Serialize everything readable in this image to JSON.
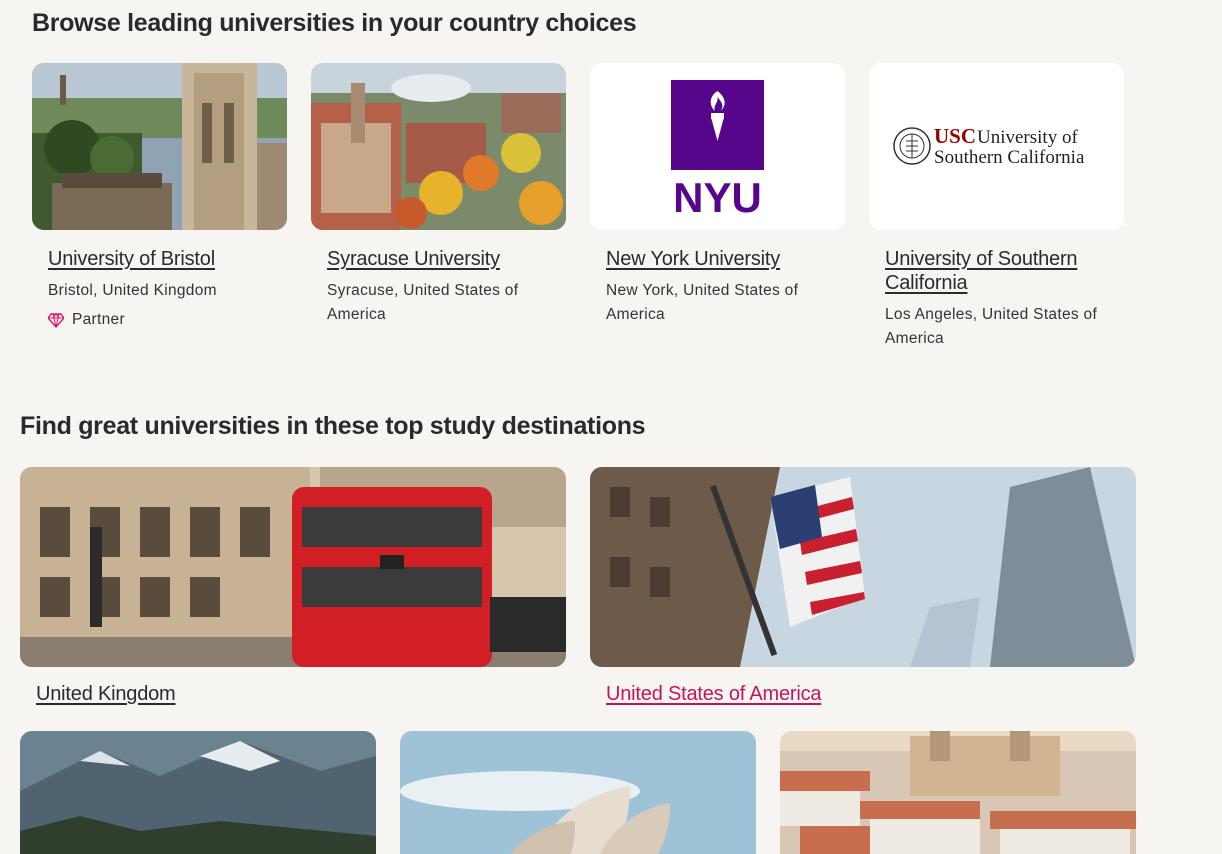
{
  "sections": {
    "browse_heading": "Browse leading universities in your country choices",
    "destinations_heading": "Find great universities in these top study destinations"
  },
  "universities": [
    {
      "name": "University of Bristol",
      "location": "Bristol, United Kingdom",
      "badge": "Partner",
      "image": "bristol-campus-photo"
    },
    {
      "name": "Syracuse University",
      "location": "Syracuse, United States of America",
      "image": "syracuse-campus-photo"
    },
    {
      "name": "New York University",
      "location": "New York, United States of America",
      "image": "nyu-logo",
      "logo_text": "NYU",
      "logo_color": "#57068c"
    },
    {
      "name": "University of Southern California",
      "location": "Los Angeles, United States of America",
      "image": "usc-logo",
      "logo_text_red": "USC",
      "logo_text_line1": "University of",
      "logo_text_line2": "Southern California",
      "logo_color": "#990000"
    }
  ],
  "destinations": [
    {
      "name": "United Kingdom",
      "image": "london-bus-photo"
    },
    {
      "name": "United States of America",
      "image": "us-flag-skyscraper-photo",
      "link_color": "#c4155c"
    }
  ],
  "more_destinations": [
    {
      "image": "mountain-landscape-photo"
    },
    {
      "image": "sydney-opera-house-photo"
    },
    {
      "image": "lisbon-cityscape-photo"
    }
  ],
  "colors": {
    "background": "#f7f5f2",
    "partner_accent": "#d6186b",
    "hover_link": "#c4155c"
  }
}
